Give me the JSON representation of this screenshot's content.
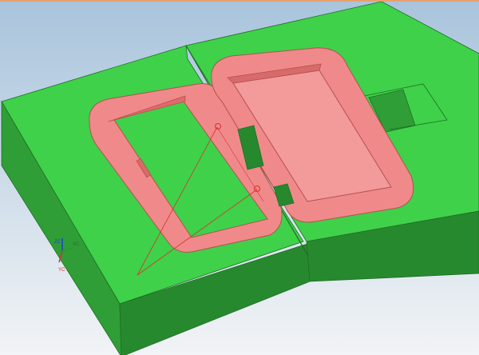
{
  "viewport": {
    "background_top": "#a9c4dc",
    "background_bottom": "#f2f4f6"
  },
  "model": {
    "mold_base_color": "#3fd14a",
    "mold_side_color": "#2f9e36",
    "mold_front_color": "#27892e",
    "cavity_color": "#f08a8a",
    "cavity_edge_color": "#b45050",
    "datum_line_color": "#d83030"
  },
  "triad": {
    "x_label": "XC",
    "y_label": "YC",
    "z_label": "ZC"
  }
}
